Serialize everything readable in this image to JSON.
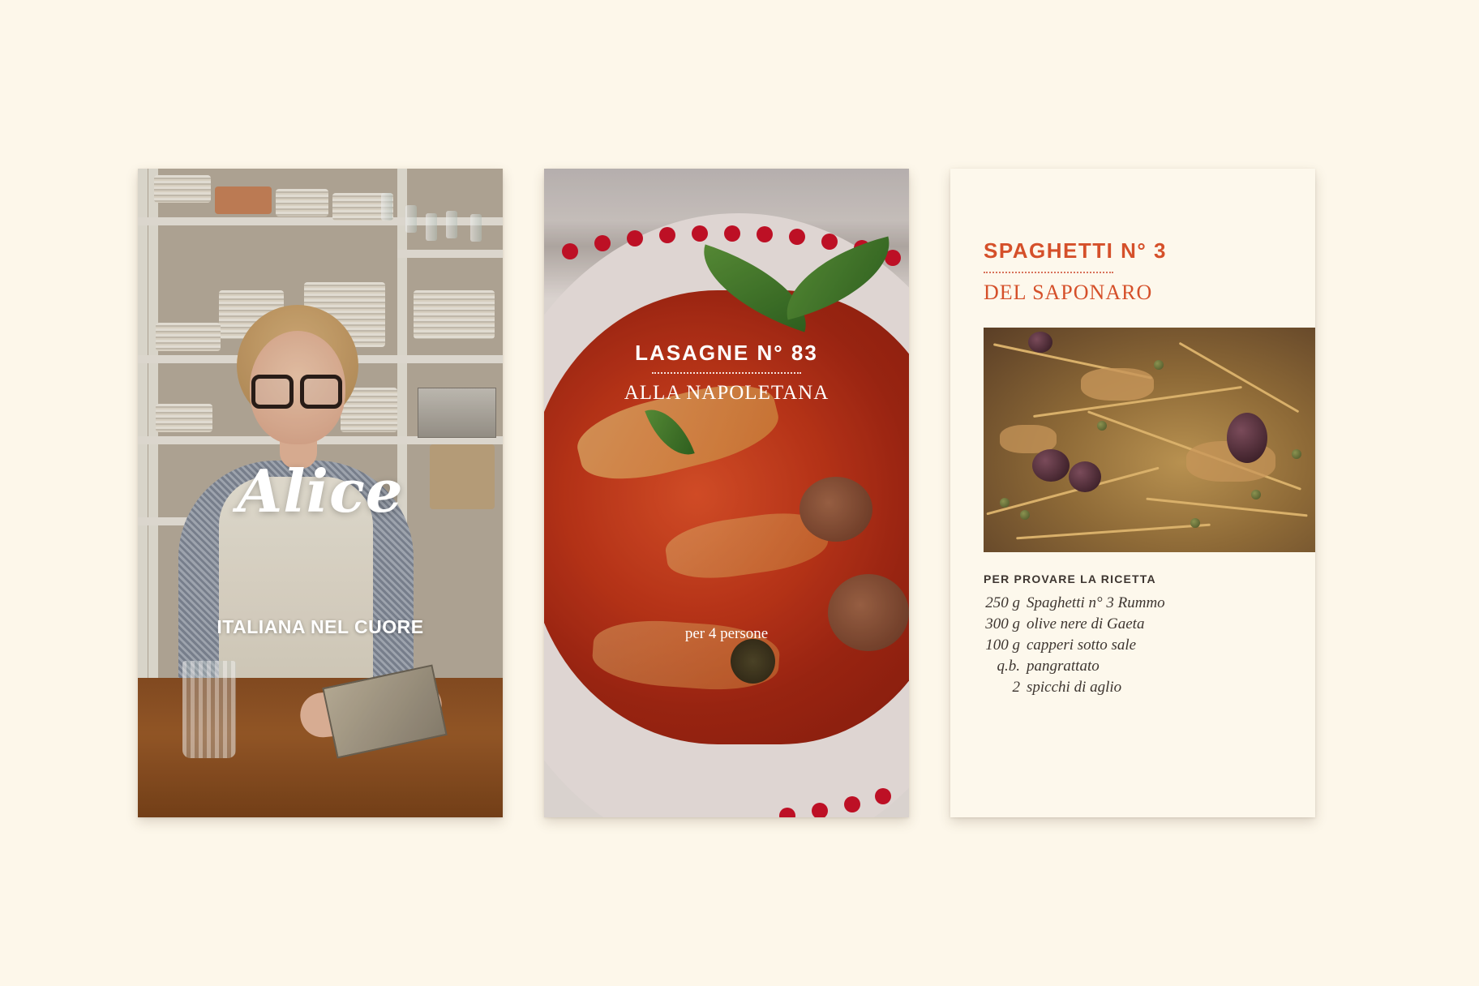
{
  "cards": {
    "portrait": {
      "name": "Alice",
      "subtitle": "ITALIANA NEL CUORE"
    },
    "lasagne": {
      "title": "LASAGNE N° 83",
      "subtitle": "ALLA NAPOLETANA",
      "serves": "per 4 persone"
    },
    "spaghetti": {
      "title": "SPAGHETTI N° 3",
      "subtitle": "DEL SAPONARO",
      "ingredients_label": "PER PROVARE LA RICETTA",
      "ingredients": [
        {
          "qty": "250 g",
          "name": "Spaghetti n° 3 Rummo"
        },
        {
          "qty": "300 g",
          "name": "olive nere di Gaeta"
        },
        {
          "qty": "100 g",
          "name": "capperi sotto sale"
        },
        {
          "qty": "q.b.",
          "name": "pangrattato"
        },
        {
          "qty": "2",
          "name": "spicchi di aglio"
        }
      ]
    }
  },
  "colors": {
    "background": "#fdf7ea",
    "accent": "#d5502a",
    "text": "#3d3530"
  }
}
